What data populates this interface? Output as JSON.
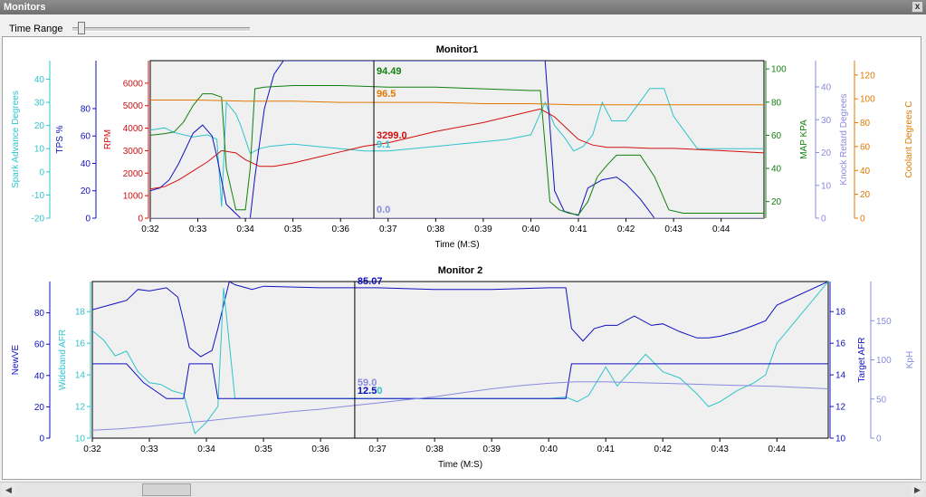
{
  "window": {
    "title": "Monitors",
    "close_label": "x"
  },
  "toolbar": {
    "time_range_label": "Time Range",
    "time_range_level": 0.05
  },
  "scrollbar": {
    "position": 0.15,
    "left_arrow": "◀",
    "right_arrow": "▶"
  },
  "chart_data": [
    {
      "type": "line",
      "title": "Monitor1",
      "xlabel": "Time (M:S)",
      "xlim": [
        32,
        44.9
      ],
      "x_ticks": [
        "0:32",
        "0:33",
        "0:34",
        "0:35",
        "0:36",
        "0:37",
        "0:38",
        "0:39",
        "0:40",
        "0:41",
        "0:42",
        "0:43",
        "0:44"
      ],
      "cursor_x": 36.7,
      "axes": [
        {
          "id": "sa",
          "label": "Spark Advance Degrees",
          "color": "#2ec4cc",
          "min": -20,
          "max": 48,
          "ticks": [
            -20,
            -10,
            0,
            10,
            20,
            30,
            40
          ],
          "side": "left"
        },
        {
          "id": "tps",
          "label": "TPS %",
          "color": "#1010c0",
          "min": 0,
          "max": 115,
          "ticks": [
            0,
            20,
            40,
            60,
            80
          ],
          "side": "left"
        },
        {
          "id": "rpm",
          "label": "RPM",
          "color": "#d01010",
          "min": 0,
          "max": 7000,
          "ticks": [
            0,
            1000,
            2000,
            3000,
            4000,
            5000,
            6000
          ],
          "side": "left"
        },
        {
          "id": "map",
          "label": "MAP KPA",
          "color": "#108010",
          "min": 10,
          "max": 105,
          "ticks": [
            20,
            40,
            60,
            80,
            100
          ],
          "side": "right"
        },
        {
          "id": "kr",
          "label": "Knock Retard Degrees",
          "color": "#8a8ae0",
          "min": 0,
          "max": 48,
          "ticks": [
            0,
            10,
            20,
            30,
            40
          ],
          "side": "right"
        },
        {
          "id": "clt",
          "label": "Coolant Degrees C",
          "color": "#e07800",
          "min": 0,
          "max": 132,
          "ticks": [
            0,
            20,
            40,
            60,
            80,
            100,
            120
          ],
          "side": "right"
        }
      ],
      "series": [
        {
          "name": "Spark Advance Degrees",
          "axis": "sa",
          "color": "#2ec4cc",
          "x": [
            32,
            32.3,
            32.5,
            32.9,
            33.2,
            33.4,
            33.5,
            33.6,
            33.8,
            33.9,
            34.1,
            34.3,
            34.5,
            35,
            35.5,
            36,
            36.5,
            37,
            37.5,
            38,
            38.5,
            39,
            39.5,
            40,
            40.3,
            40.5,
            40.7,
            40.9,
            41.1,
            41.3,
            41.5,
            41.7,
            42,
            42.5,
            42.8,
            43,
            43.5,
            44,
            44.9
          ],
          "y": [
            18,
            19,
            17,
            15,
            16,
            14,
            -15,
            30,
            25,
            20,
            8,
            10,
            11,
            12,
            11,
            10,
            9,
            9,
            10,
            11,
            12,
            13,
            14,
            16,
            30,
            20,
            15,
            9,
            11,
            16,
            30,
            22,
            22,
            36,
            36,
            24,
            10,
            10,
            10
          ],
          "end_label": "9.1"
        },
        {
          "name": "TPS %",
          "axis": "tps",
          "color": "#1010c0",
          "x": [
            32,
            32.2,
            32.4,
            32.6,
            32.9,
            33.1,
            33.3,
            33.4,
            33.6,
            33.9,
            34.1,
            34.2,
            34.4,
            34.6,
            34.8,
            35,
            36,
            37,
            38,
            39,
            40,
            40.3,
            40.5,
            40.7,
            41,
            41.2,
            41.5,
            41.8,
            42,
            42.3,
            42.6,
            42.9,
            44.9
          ],
          "y": [
            20,
            22,
            28,
            40,
            62,
            68,
            60,
            45,
            10,
            0,
            0,
            30,
            80,
            105,
            115,
            115,
            115,
            115,
            115,
            115,
            115,
            115,
            20,
            5,
            2,
            22,
            28,
            30,
            25,
            14,
            0,
            0,
            0
          ],
          "end_label": "0.0"
        },
        {
          "name": "RPM",
          "axis": "rpm",
          "color": "#d01010",
          "x": [
            32,
            32.3,
            32.6,
            32.9,
            33.2,
            33.5,
            33.8,
            34,
            34.3,
            34.6,
            35,
            35.5,
            36,
            36.5,
            37,
            37.5,
            38,
            38.5,
            39,
            39.5,
            40,
            40.2,
            40.5,
            40.8,
            41,
            41.3,
            41.6,
            42,
            42.5,
            43,
            44,
            44.9
          ],
          "y": [
            1300,
            1400,
            1700,
            2100,
            2500,
            3000,
            2900,
            2600,
            2300,
            2300,
            2450,
            2700,
            2950,
            3200,
            3350,
            3600,
            3850,
            4050,
            4250,
            4500,
            4750,
            4850,
            4500,
            3900,
            3500,
            3250,
            3150,
            3150,
            3100,
            3100,
            3000,
            2900
          ],
          "end_label": "3299.0"
        },
        {
          "name": "MAP KPA",
          "axis": "map",
          "color": "#108010",
          "x": [
            32,
            32.3,
            32.5,
            32.7,
            32.9,
            33.1,
            33.3,
            33.5,
            33.6,
            33.8,
            34,
            34.1,
            34.2,
            34.4,
            35,
            36,
            37,
            38,
            39,
            40,
            40.2,
            40.4,
            40.6,
            40.8,
            41,
            41.2,
            41.4,
            41.6,
            41.8,
            42,
            42.3,
            42.6,
            42.9,
            43.2,
            44,
            44.9
          ],
          "y": [
            60,
            61,
            62,
            68,
            78,
            85,
            85,
            83,
            40,
            15,
            15,
            40,
            88,
            89,
            90,
            90,
            89,
            89,
            88,
            87,
            87,
            20,
            15,
            13,
            12,
            20,
            35,
            42,
            48,
            48,
            48,
            35,
            15,
            13,
            13,
            13
          ],
          "end_label": "94.49"
        },
        {
          "name": "Knock Retard Degrees",
          "axis": "kr",
          "color": "#8a8ae0",
          "x": [
            32,
            44.9
          ],
          "y": [
            0,
            0
          ],
          "end_label": "0.0"
        },
        {
          "name": "Coolant Degrees C",
          "axis": "clt",
          "color": "#e07800",
          "x": [
            32,
            33,
            34,
            35,
            36,
            37,
            38,
            39,
            40,
            41,
            42,
            43,
            44,
            44.9
          ],
          "y": [
            99,
            99,
            98,
            98,
            97,
            97,
            97,
            96,
            96,
            95,
            95,
            95,
            95,
            95
          ],
          "end_label": "96.5"
        }
      ],
      "cursor_labels": [
        {
          "text": "94.49",
          "series": "MAP KPA"
        },
        {
          "text": "96.5",
          "series": "Coolant Degrees C"
        },
        {
          "text": "3299.0",
          "series": "RPM"
        },
        {
          "text": "9.1",
          "series": "Spark Advance Degrees"
        },
        {
          "text": "0.0",
          "series": "Knock Retard Degrees"
        }
      ]
    },
    {
      "type": "line",
      "title": "Monitor 2",
      "xlabel": "Time (M:S)",
      "xlim": [
        32,
        44.9
      ],
      "x_ticks": [
        "0:32",
        "0:33",
        "0:34",
        "0:35",
        "0:36",
        "0:37",
        "0:38",
        "0:39",
        "0:40",
        "0:41",
        "0:42",
        "0:43",
        "0:44"
      ],
      "cursor_x": 36.6,
      "axes": [
        {
          "id": "ve",
          "label": "NewVE",
          "color": "#1010c0",
          "min": 0,
          "max": 100,
          "ticks": [
            0,
            20,
            40,
            60,
            80
          ],
          "side": "left"
        },
        {
          "id": "wb",
          "label": "Wideband AFR",
          "color": "#2ec4cc",
          "min": 10,
          "max": 19.9,
          "ticks": [
            10,
            12,
            14,
            16,
            18
          ],
          "side": "left"
        },
        {
          "id": "tafr",
          "label": "Target AFR",
          "color": "#1010c0",
          "min": 10,
          "max": 19.9,
          "ticks": [
            10,
            12,
            14,
            16,
            18
          ],
          "side": "right"
        },
        {
          "id": "kph",
          "label": "KpH",
          "color": "#8a8ae0",
          "min": 0,
          "max": 200,
          "ticks": [
            0,
            50,
            100,
            150
          ],
          "side": "right"
        }
      ],
      "series": [
        {
          "name": "NewVE",
          "axis": "ve",
          "color": "#1010c0",
          "x": [
            32,
            32.3,
            32.6,
            32.8,
            33,
            33.3,
            33.5,
            33.6,
            33.7,
            33.9,
            34.1,
            34.2,
            34.4,
            34.5,
            34.8,
            35,
            36,
            37,
            38,
            39,
            40,
            40.3,
            40.4,
            40.6,
            40.8,
            41,
            41.2,
            41.5,
            41.8,
            42,
            42.3,
            42.6,
            42.8,
            43,
            43.3,
            43.6,
            43.8,
            44,
            44.9
          ],
          "y": [
            82,
            85,
            88,
            95,
            94,
            96,
            90,
            75,
            58,
            52,
            56,
            70,
            100,
            98,
            95,
            97,
            96,
            96,
            95,
            95,
            96,
            96,
            70,
            62,
            70,
            72,
            72,
            78,
            72,
            73,
            68,
            64,
            64,
            65,
            68,
            72,
            75,
            85,
            100
          ],
          "end_label": "85.07"
        },
        {
          "name": "Wideband AFR",
          "axis": "wb",
          "color": "#2ec4cc",
          "x": [
            32,
            32.2,
            32.4,
            32.6,
            32.8,
            33,
            33.2,
            33.4,
            33.6,
            33.8,
            34,
            34.2,
            34.3,
            34.5,
            34.8,
            35,
            36,
            37,
            38,
            39,
            40,
            40.3,
            40.5,
            40.7,
            41,
            41.2,
            41.5,
            41.7,
            42,
            42.3,
            42.6,
            42.8,
            43,
            43.3,
            43.6,
            43.8,
            44,
            44.9
          ],
          "y": [
            16.8,
            16.2,
            15.2,
            15.5,
            14.2,
            13.5,
            13.4,
            13,
            12.8,
            10.3,
            11,
            12,
            19.5,
            12.5,
            12.5,
            12.5,
            12.5,
            12.5,
            12.5,
            12.5,
            12.5,
            12.6,
            12.3,
            12.7,
            14.5,
            13.3,
            14.5,
            15.3,
            14.2,
            13.8,
            12.8,
            12,
            12.3,
            13,
            13.5,
            14,
            16,
            19.9
          ],
          "end_label": "12.50"
        },
        {
          "name": "Target AFR",
          "axis": "tafr",
          "color": "#1010c0",
          "x": [
            32,
            32.6,
            32.9,
            33.3,
            33.6,
            33.7,
            34.1,
            34.2,
            34.5,
            36,
            38,
            40,
            40.2,
            40.3,
            40.4,
            41,
            42,
            43,
            44,
            44.9
          ],
          "y": [
            14.7,
            14.7,
            13.5,
            12.5,
            12.5,
            14.7,
            14.7,
            12.5,
            12.5,
            12.5,
            12.5,
            12.5,
            12.5,
            12.5,
            14.7,
            14.7,
            14.7,
            14.7,
            14.7,
            14.7
          ],
          "end_label": "12.5"
        },
        {
          "name": "KpH",
          "axis": "kph",
          "color": "#8a8ae0",
          "x": [
            32,
            32.5,
            33,
            33.5,
            34,
            34.5,
            35,
            35.5,
            36,
            36.5,
            37,
            37.5,
            38,
            38.5,
            39,
            39.5,
            40,
            40.5,
            41,
            41.5,
            42,
            42.5,
            43,
            43.5,
            44,
            44.9
          ],
          "y": [
            10,
            12,
            15,
            19,
            22,
            26,
            30,
            34,
            37,
            41,
            45,
            49,
            53,
            58,
            63,
            67,
            70,
            72,
            72,
            71,
            70,
            69,
            68,
            67,
            66,
            63
          ],
          "end_label": "59.0"
        }
      ],
      "cursor_labels": [
        {
          "text": "85.07",
          "series": "NewVE"
        },
        {
          "text": "59.0",
          "series": "KpH"
        },
        {
          "text": "12.50",
          "series": "Wideband AFR"
        },
        {
          "text": "12.5",
          "series": "Target AFR"
        }
      ]
    }
  ]
}
